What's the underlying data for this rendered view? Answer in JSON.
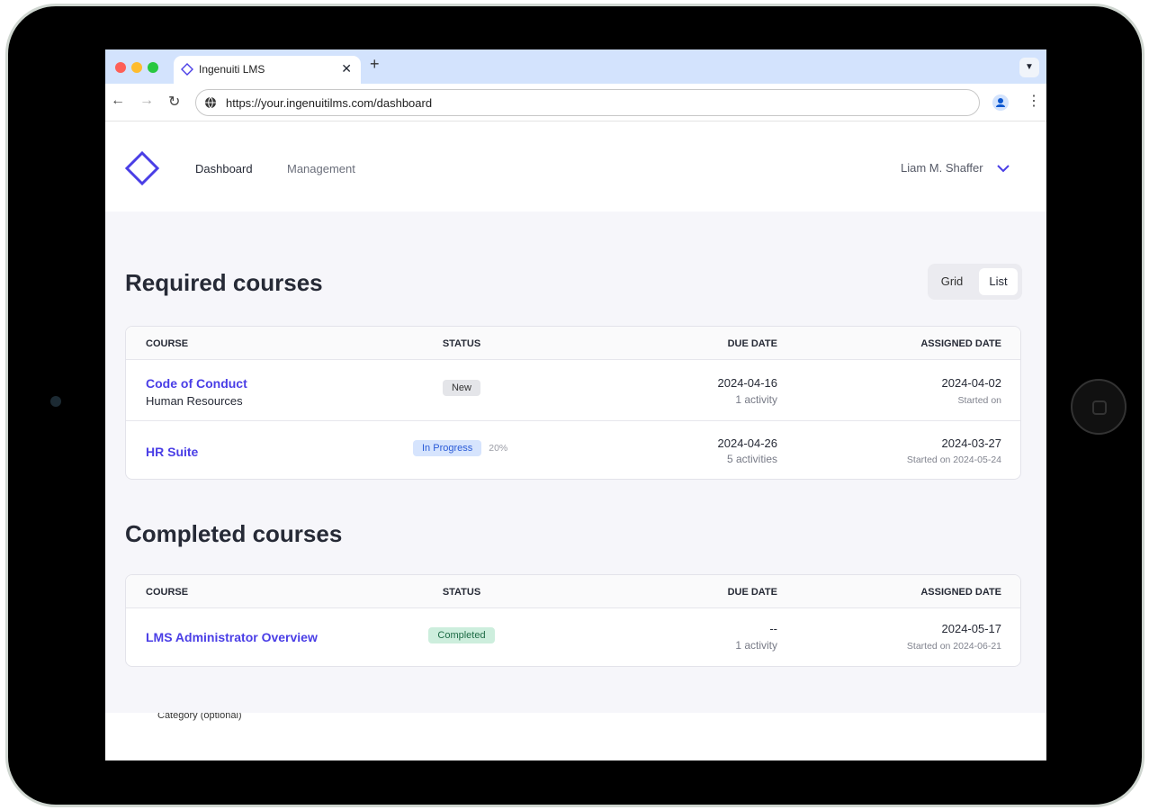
{
  "browser": {
    "tab_title": "Ingenuiti LMS",
    "url": "https://your.ingenuitilms.com/dashboard"
  },
  "header": {
    "nav": [
      "Dashboard",
      "Management"
    ],
    "user": "Liam M. Shaffer"
  },
  "view_toggle": {
    "options": [
      "Grid",
      "List"
    ],
    "selected": "List"
  },
  "columns": [
    "COURSE",
    "STATUS",
    "DUE DATE",
    "ASSIGNED DATE"
  ],
  "required": {
    "title": "Required courses",
    "rows": [
      {
        "name": "Code of Conduct",
        "category": "Human Resources",
        "status": "New",
        "progress": "",
        "due": "2024-04-16",
        "activities": "1 activity",
        "assigned": "2024-04-02",
        "started": "Started on"
      },
      {
        "name": "HR Suite",
        "category": "",
        "status": "In Progress",
        "progress": "20%",
        "due": "2024-04-26",
        "activities": "5 activities",
        "assigned": "2024-03-27",
        "started": "Started on 2024-05-24"
      }
    ]
  },
  "completed": {
    "title": "Completed courses",
    "rows": [
      {
        "name": "LMS Administrator Overview",
        "category": "",
        "status": "Completed",
        "progress": "",
        "due": "--",
        "activities": "1 activity",
        "assigned": "2024-05-17",
        "started": "Started on 2024-06-21"
      }
    ]
  },
  "ghost_label": "Category (optional)",
  "colors": {
    "accent": "#4a3ee6",
    "new": "#e4e5e9",
    "in_progress": "#d6e4fd",
    "completed": "#cdeedd"
  }
}
